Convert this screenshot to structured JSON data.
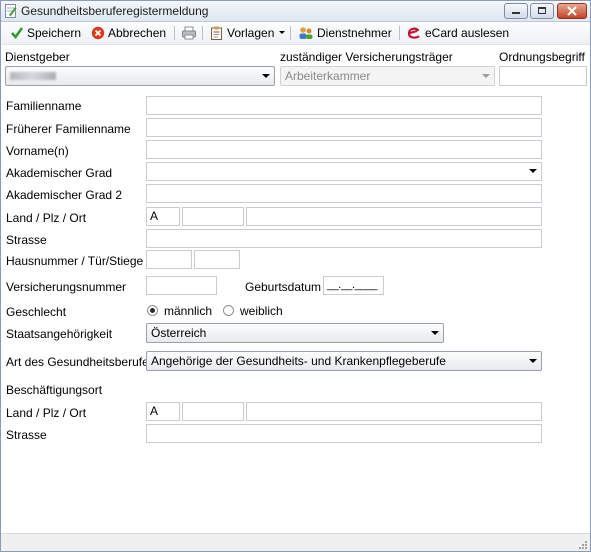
{
  "window": {
    "title": "Gesundheitsberuferegistermeldung"
  },
  "toolbar": {
    "save_label": "Speichern",
    "cancel_label": "Abbrechen",
    "templates_label": "Vorlagen",
    "employees_label": "Dienstnehmer",
    "ecard_label": "eCard auslesen"
  },
  "header": {
    "employer_label": "Dienstgeber",
    "employer_value": "",
    "insurer_label": "zuständiger Versicherungsträger",
    "insurer_value": "Arbeiterkammer",
    "order_label": "Ordnungsbegriff",
    "order_value": ""
  },
  "form": {
    "lastname_label": "Familienname",
    "former_lastname_label": "Früherer Familienname",
    "firstnames_label": "Vorname(n)",
    "academic_label": "Akademischer Grad",
    "academic2_label": "Akademischer Grad 2",
    "country_zip_city_label": "Land / Plz / Ort",
    "country_value": "A",
    "street_label": "Strasse",
    "house_label": "Hausnummer / Tür/Stiege",
    "insurance_no_label": "Versicherungsnummer",
    "birthdate_label": "Geburtsdatum",
    "birthdate_value": "__.__.____",
    "gender_label": "Geschlecht",
    "gender_male": "männlich",
    "gender_female": "weiblich",
    "gender_selected": "male",
    "citizenship_label": "Staatsangehörigkeit",
    "citizenship_value": "Österreich",
    "profession_label": "Art des Gesundheitsberufes",
    "profession_value": "Angehörige der Gesundheits- und Krankenpflegeberufe",
    "workplace_label": "Beschäftigungsort",
    "work_country_zip_city_label": "Land / Plz / Ort",
    "work_country_value": "A",
    "work_street_label": "Strasse"
  },
  "colors": {
    "save_icon": "#2e9a2e",
    "cancel_icon": "#d83a1a",
    "ecard_icon": "#c8102e",
    "close_button": "#c2452a"
  },
  "icons": {
    "save": "checkmark-icon",
    "cancel": "cancel-icon",
    "print": "printer-icon",
    "templates": "clipboard-icon",
    "employees": "people-icon",
    "ecard": "ecard-icon"
  }
}
